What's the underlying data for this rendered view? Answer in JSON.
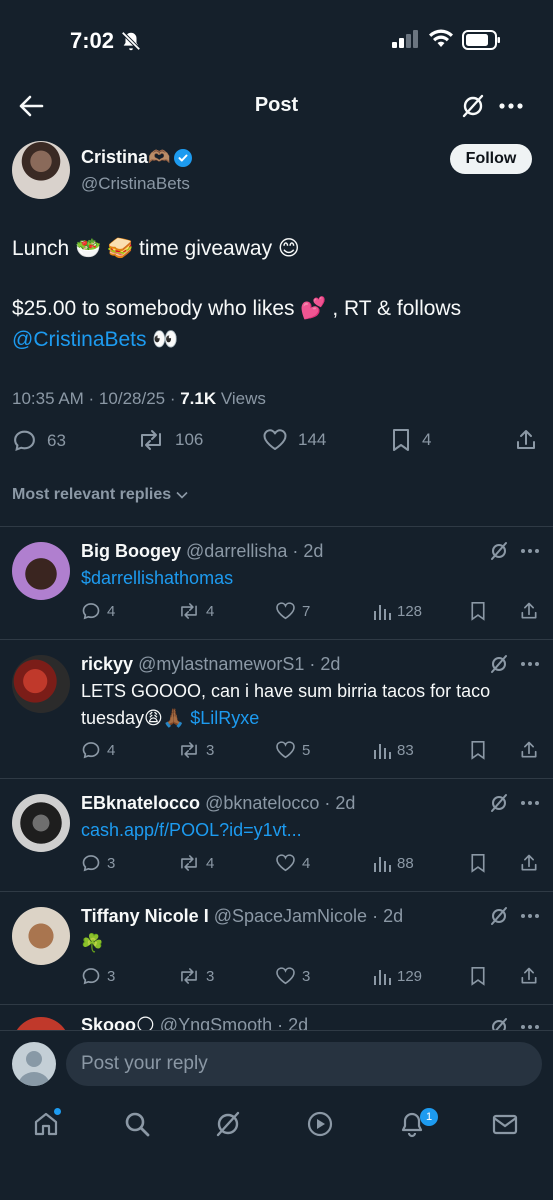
{
  "status_bar": {
    "time": "7:02"
  },
  "header": {
    "title": "Post"
  },
  "author": {
    "name": "Cristina🫶🏽",
    "handle": "@CristinaBets",
    "follow_label": "Follow"
  },
  "tweet": {
    "line1": "Lunch 🥗 🥪 time giveaway 😊",
    "line2": "$25.00 to somebody who likes 💕 , RT & follows",
    "mention": "@CristinaBets",
    "mention_suffix": " 👀",
    "time": "10:35 AM · 10/28/25 · ",
    "views_count": "7.1K",
    "views_label": " Views"
  },
  "actions": {
    "replies": "63",
    "reposts": "106",
    "likes": "144",
    "bookmarks": "4"
  },
  "replies_sort": "Most relevant replies",
  "replies": [
    {
      "name": "Big Boogey",
      "handle": "@darrellisha",
      "age": "2d",
      "text": "",
      "link": "$darrellishathomas",
      "replies": "4",
      "reposts": "4",
      "likes": "7",
      "views": "128"
    },
    {
      "name": "rickyy",
      "handle": "@mylastnameworS1",
      "age": "2d",
      "text": "LETS GOOOO, can i have sum birria tacos for taco tuesday😩🙏🏾 ",
      "link": "$LilRyxe",
      "replies": "4",
      "reposts": "3",
      "likes": "5",
      "views": "83"
    },
    {
      "name": "EBknatelocco",
      "handle": "@bknatelocco",
      "age": "2d",
      "text": "",
      "link": "cash.app/f/POOL?id=y1vt...",
      "replies": "3",
      "reposts": "4",
      "likes": "4",
      "views": "88"
    },
    {
      "name": "Tiffany Nicole I",
      "handle": "@SpaceJamNicole",
      "age": "2d",
      "text": "☘️",
      "link": "",
      "replies": "3",
      "reposts": "3",
      "likes": "3",
      "views": "129"
    },
    {
      "name": "Skooo🌕",
      "handle": "@YngSmooth",
      "age": "2d"
    }
  ],
  "composer": {
    "placeholder": "Post your reply"
  },
  "tabbar": {
    "notifications_badge": "1"
  },
  "colors": {
    "background": "#15202b",
    "accent": "#1d9bf0",
    "muted": "#8b98a5"
  }
}
